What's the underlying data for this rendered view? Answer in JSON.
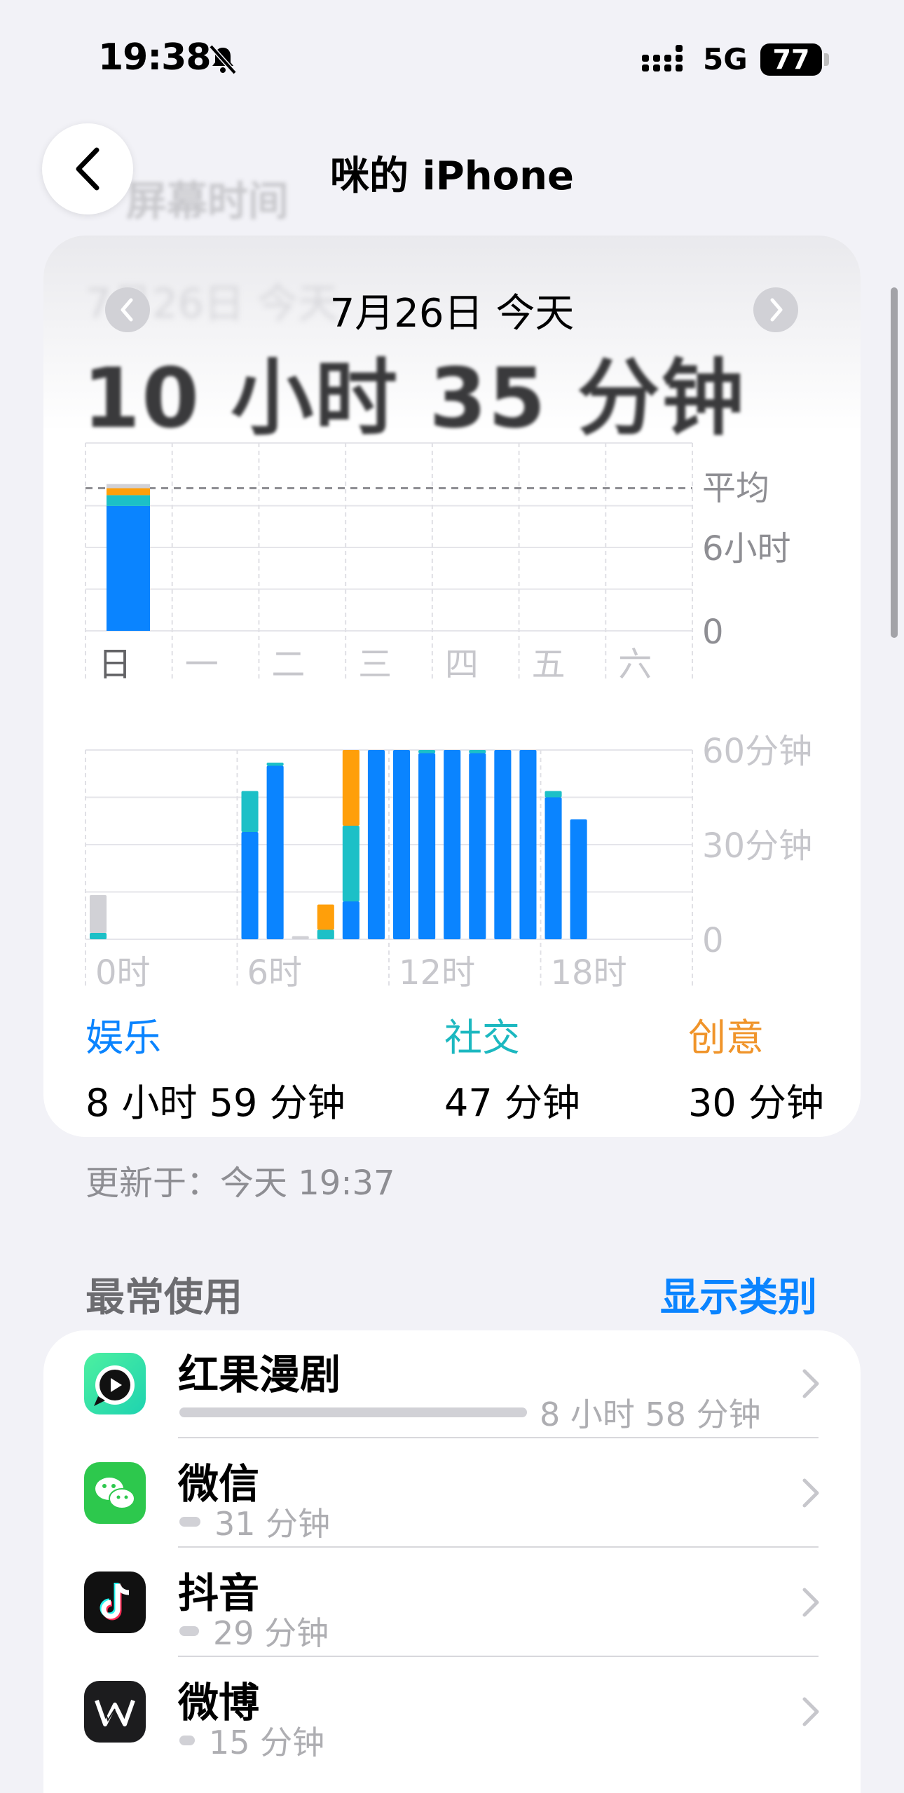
{
  "status_bar": {
    "time": "19:38",
    "network": "5G",
    "battery": "77"
  },
  "nav": {
    "title": "咪的 iPhone",
    "ghost_title": "屏幕时间",
    "back_icon": "chevron-left-icon"
  },
  "summary": {
    "ghost_date": "7月26日 今天",
    "date_label": "7月26日 今天",
    "total_time": "10 小时 35 分钟",
    "updated": "更新于：今天 19:37"
  },
  "legend": [
    {
      "category": "娱乐",
      "time": "8 小时 59 分钟",
      "color": "#0a84ff"
    },
    {
      "category": "社交",
      "time": "47 分钟",
      "color": "#1cc0c7"
    },
    {
      "category": "创意",
      "time": "30 分钟",
      "color": "#ff9f0a"
    }
  ],
  "chart_data": [
    {
      "type": "bar",
      "stacked": true,
      "categories": [
        "日",
        "一",
        "二",
        "三",
        "四",
        "五",
        "六"
      ],
      "yticks": [
        "平均",
        "6小时",
        "0"
      ],
      "ylim_hours": [
        0,
        12
      ],
      "average_line": "平均",
      "series": [
        {
          "name": "娱乐",
          "color": "#0a84ff",
          "values": [
            8.98,
            0,
            0,
            0,
            0,
            0,
            0
          ]
        },
        {
          "name": "社交",
          "color": "#1cc0c7",
          "values": [
            0.78,
            0,
            0,
            0,
            0,
            0,
            0
          ]
        },
        {
          "name": "创意",
          "color": "#ff9f0a",
          "values": [
            0.5,
            0,
            0,
            0,
            0,
            0,
            0
          ]
        },
        {
          "color": "#d1d1d6",
          "values": [
            0.3,
            0,
            0,
            0,
            0,
            0,
            0
          ]
        }
      ]
    },
    {
      "type": "bar",
      "stacked": true,
      "x_hours": [
        0,
        1,
        2,
        3,
        4,
        5,
        6,
        7,
        8,
        9,
        10,
        11,
        12,
        13,
        14,
        15,
        16,
        17,
        18,
        19,
        20,
        21,
        22,
        23
      ],
      "xticks": [
        "0时",
        "6时",
        "12时",
        "18时"
      ],
      "yticks": [
        "60分钟",
        "30分钟",
        "0"
      ],
      "ylim_minutes": [
        0,
        60
      ],
      "series": [
        {
          "name": "娱乐",
          "color": "#0a84ff",
          "values": [
            0,
            0,
            0,
            0,
            0,
            0,
            34,
            55,
            0,
            0,
            12,
            60,
            60,
            59,
            60,
            59,
            60,
            60,
            45,
            38,
            0,
            0,
            0,
            0
          ]
        },
        {
          "name": "社交",
          "color": "#1cc0c7",
          "values": [
            2,
            0,
            0,
            0,
            0,
            0,
            13,
            1,
            0,
            3,
            24,
            0,
            0,
            1,
            0,
            1,
            0,
            0,
            2,
            0,
            0,
            0,
            0,
            0
          ]
        },
        {
          "name": "创意",
          "color": "#ff9f0a",
          "values": [
            0,
            0,
            0,
            0,
            0,
            0,
            0,
            0,
            0,
            8,
            24,
            0,
            0,
            0,
            0,
            0,
            0,
            0,
            0,
            0,
            0,
            0,
            0,
            0
          ]
        },
        {
          "color": "#d1d1d6",
          "values": [
            12,
            0,
            0,
            0,
            0,
            0,
            0,
            0,
            1,
            0,
            0,
            0,
            0,
            0,
            0,
            0,
            0,
            0,
            0,
            0,
            0,
            0,
            0,
            0
          ]
        }
      ]
    }
  ],
  "most_used": {
    "title": "最常使用",
    "show_categories": "显示类别",
    "apps": [
      {
        "name": "红果漫剧",
        "time": "8 小时 58 分钟",
        "icon": "hongguo-icon",
        "fraction": 1.0
      },
      {
        "name": "微信",
        "time": "31 分钟",
        "icon": "wechat-icon",
        "fraction": 0.058
      },
      {
        "name": "抖音",
        "time": "29 分钟",
        "icon": "douyin-icon",
        "fraction": 0.054
      },
      {
        "name": "微博",
        "time": "15 分钟",
        "icon": "weibo-icon",
        "fraction": 0.028
      }
    ]
  }
}
